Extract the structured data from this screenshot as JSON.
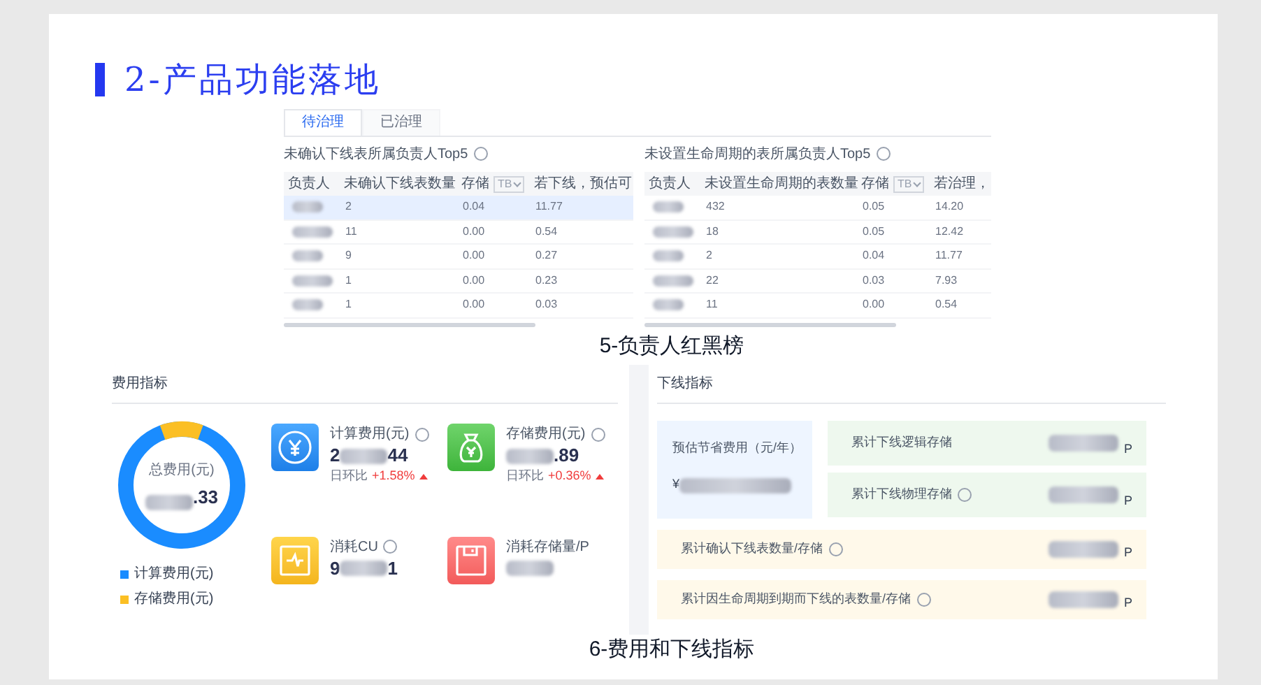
{
  "slide_title": "2-产品功能落地",
  "owner_board": {
    "tabs": [
      {
        "label": "待治理",
        "selected": true
      },
      {
        "label": "已治理",
        "selected": false
      }
    ],
    "tables": [
      {
        "title": "未确认下线表所属负责人Top5",
        "columns": [
          "负责人",
          "未确认下线表数量",
          "存储",
          "若下线，预估可"
        ],
        "unit": "TB",
        "rows": [
          {
            "count": "2",
            "storage": "0.04",
            "estimate": "11.77",
            "selected": true
          },
          {
            "count": "11",
            "storage": "0.00",
            "estimate": "0.54",
            "selected": false
          },
          {
            "count": "9",
            "storage": "0.00",
            "estimate": "0.27",
            "selected": false
          },
          {
            "count": "1",
            "storage": "0.00",
            "estimate": "0.23",
            "selected": false
          },
          {
            "count": "1",
            "storage": "0.00",
            "estimate": "0.03",
            "selected": false
          }
        ]
      },
      {
        "title": "未设置生命周期的表所属负责人Top5",
        "columns": [
          "负责人",
          "未设置生命周期的表数量",
          "存储",
          "若治理，"
        ],
        "unit": "TB",
        "rows": [
          {
            "count": "432",
            "storage": "0.05",
            "estimate": "14.20",
            "selected": false
          },
          {
            "count": "18",
            "storage": "0.05",
            "estimate": "12.42",
            "selected": false
          },
          {
            "count": "2",
            "storage": "0.04",
            "estimate": "11.77",
            "selected": false
          },
          {
            "count": "22",
            "storage": "0.03",
            "estimate": "7.93",
            "selected": false
          },
          {
            "count": "11",
            "storage": "0.00",
            "estimate": "0.54",
            "selected": false
          }
        ]
      }
    ],
    "caption": "5-负责人红黑榜"
  },
  "cost_panel": {
    "title": "费用指标",
    "total_label": "总费用(元)",
    "total_tail": ".33",
    "legend": [
      {
        "label": "计算费用(元)",
        "color": "#1a8cff"
      },
      {
        "label": "存储费用(元)",
        "color": "#fbbf24"
      }
    ],
    "metrics": [
      {
        "kind": "yuan",
        "label": "计算费用(元)",
        "help": true,
        "value_head": "2",
        "value_tail": "44",
        "change_label": "日环比",
        "change": "+1.58%"
      },
      {
        "kind": "moneybag",
        "label": "存储费用(元)",
        "help": true,
        "value_tail": ".89",
        "change_label": "日环比",
        "change": "+0.36%"
      },
      {
        "kind": "pulse",
        "label": "消耗CU",
        "help": true,
        "value_head": "9",
        "value_tail": "1"
      },
      {
        "kind": "disk",
        "label": "消耗存储量/P",
        "help": false
      }
    ]
  },
  "offline_panel": {
    "title": "下线指标",
    "estimate": {
      "label": "预估节省费用（元/年）",
      "currency": "¥"
    },
    "storage_rows": [
      {
        "label": "累计下线逻辑存储",
        "help": false,
        "unit": "P"
      },
      {
        "label": "累计下线物理存储",
        "help": true,
        "unit": "P"
      }
    ],
    "count_rows": [
      {
        "label": "累计确认下线表数量/存储",
        "help": true,
        "unit": "P"
      },
      {
        "label": "累计因生命周期到期而下线的表数量/存储",
        "help": true,
        "unit": "P"
      }
    ]
  },
  "caption": "6-费用和下线指标"
}
